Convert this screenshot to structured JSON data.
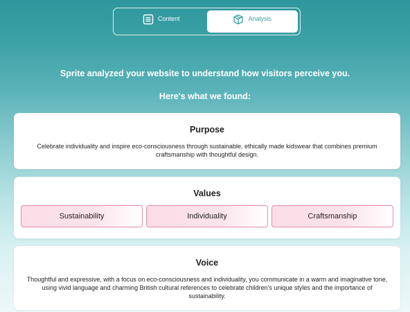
{
  "tabs": [
    {
      "label": "Content",
      "icon": "document-icon",
      "active": false
    },
    {
      "label": "Analysis",
      "icon": "cube-icon",
      "active": true
    }
  ],
  "intro": {
    "line1": "Sprite analyzed your website to understand how visitors perceive you.",
    "line2": "Here's what we found:"
  },
  "purpose": {
    "title": "Purpose",
    "text": "Celebrate individuality and inspire eco-consciousness through sustainable, ethically made kidswear that combines premium craftsmanship with thoughtful design."
  },
  "values": {
    "title": "Values",
    "items": [
      "Sustainability",
      "Individuality",
      "Craftsmanship"
    ]
  },
  "voice": {
    "title": "Voice",
    "text": "Thoughtful and expressive, with a focus on eco-consciousness and individuality, you communicate in a warm and imaginative tone, using vivid language and charming British cultural references to celebrate children's unique styles and the importance of sustainability."
  },
  "colors": {
    "accent": "#3aa0a6",
    "pill_border": "#e88aa6",
    "pill_fill": "#fbdde7"
  }
}
